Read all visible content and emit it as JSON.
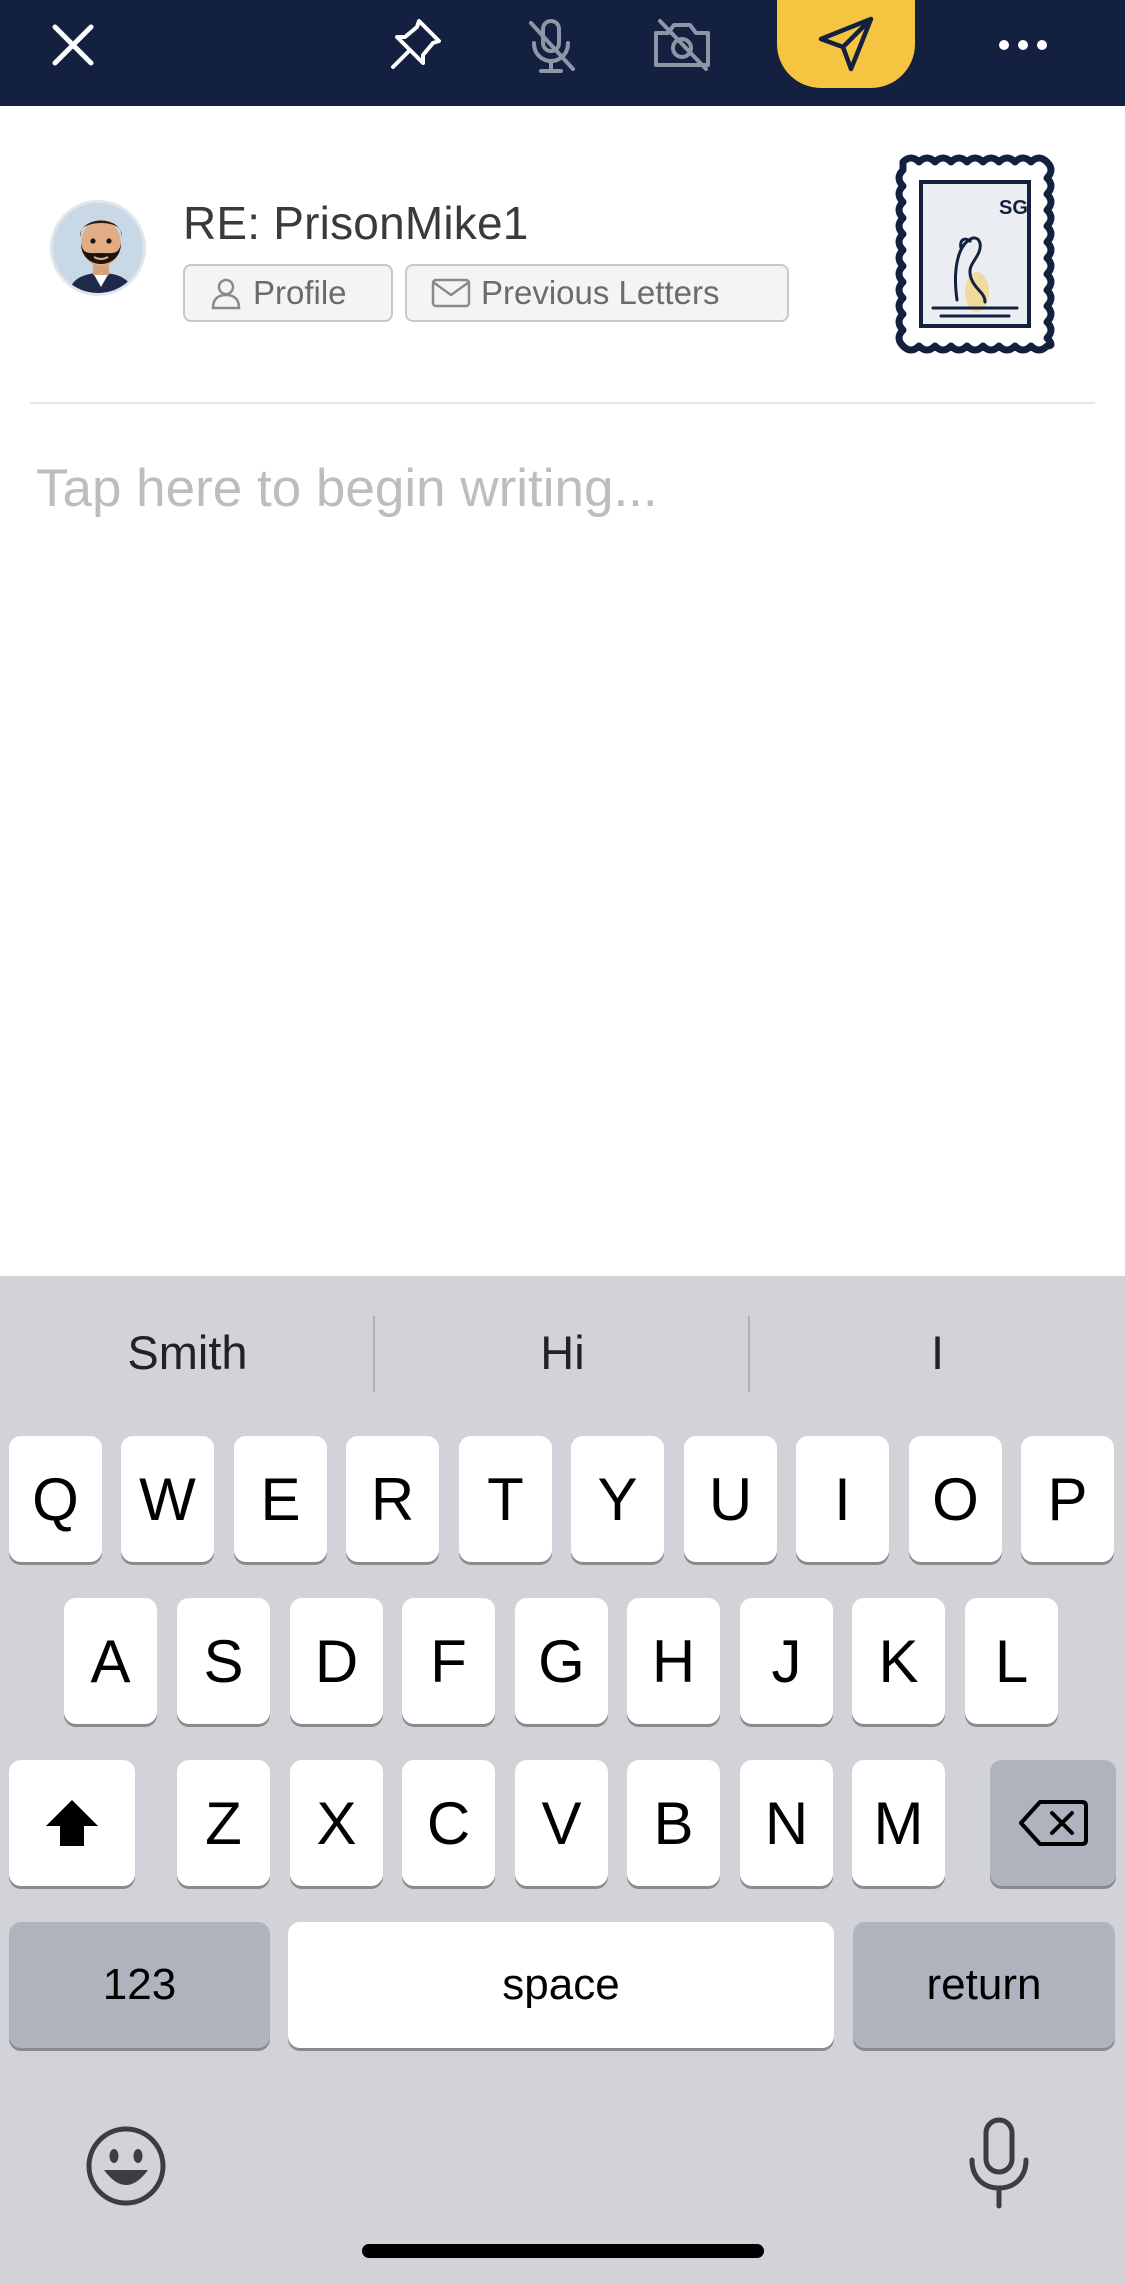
{
  "topbar": {
    "background": "#13203f",
    "accent": "#f5c542",
    "icons": [
      "close-icon",
      "pin-icon",
      "mic-off-icon",
      "camera-off-icon",
      "send-icon",
      "more-icon"
    ]
  },
  "letter": {
    "recipient": "RE: PrisonMike1",
    "profile_label": "Profile",
    "previous_letters_label": "Previous Letters",
    "stamp_text": "SG",
    "editor_placeholder": "Tap here to begin writing..."
  },
  "keyboard": {
    "suggestions": [
      "Smith",
      "Hi",
      "I"
    ],
    "row1": [
      "Q",
      "W",
      "E",
      "R",
      "T",
      "Y",
      "U",
      "I",
      "O",
      "P"
    ],
    "row2": [
      "A",
      "S",
      "D",
      "F",
      "G",
      "H",
      "J",
      "K",
      "L"
    ],
    "row3": [
      "Z",
      "X",
      "C",
      "V",
      "B",
      "N",
      "M"
    ],
    "numbers_label": "123",
    "space_label": "space",
    "return_label": "return"
  }
}
